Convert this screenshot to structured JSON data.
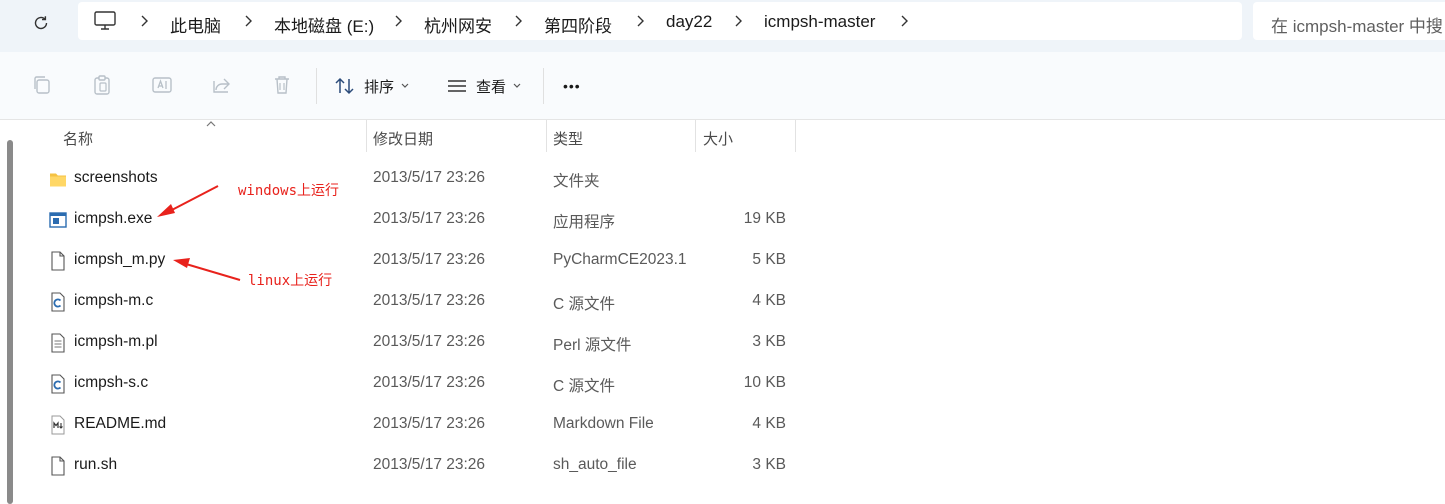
{
  "address": {
    "breadcrumbs": [
      "此电脑",
      "本地磁盘 (E:)",
      "杭州网安",
      "第四阶段",
      "day22",
      "icmpsh-master"
    ],
    "search_placeholder": "在 icmpsh-master 中搜"
  },
  "toolbar": {
    "sort_label": "排序",
    "view_label": "查看",
    "more_label": "•••"
  },
  "columns": {
    "name": "名称",
    "modified": "修改日期",
    "type": "类型",
    "size": "大小"
  },
  "files": [
    {
      "name": "screenshots",
      "modified": "2013/5/17 23:26",
      "type": "文件夹",
      "size": "",
      "icon": "folder-icon"
    },
    {
      "name": "icmpsh.exe",
      "modified": "2013/5/17 23:26",
      "type": "应用程序",
      "size": "19 KB",
      "icon": "exe-icon"
    },
    {
      "name": "icmpsh_m.py",
      "modified": "2013/5/17 23:26",
      "type": "PyCharmCE2023.1",
      "size": "5 KB",
      "icon": "file-icon"
    },
    {
      "name": "icmpsh-m.c",
      "modified": "2013/5/17 23:26",
      "type": "C 源文件",
      "size": "4 KB",
      "icon": "c-file-icon"
    },
    {
      "name": "icmpsh-m.pl",
      "modified": "2013/5/17 23:26",
      "type": "Perl 源文件",
      "size": "3 KB",
      "icon": "text-file-icon"
    },
    {
      "name": "icmpsh-s.c",
      "modified": "2013/5/17 23:26",
      "type": "C 源文件",
      "size": "10 KB",
      "icon": "c-file-icon"
    },
    {
      "name": "README.md",
      "modified": "2013/5/17 23:26",
      "type": "Markdown File",
      "size": "4 KB",
      "icon": "markdown-file-icon"
    },
    {
      "name": "run.sh",
      "modified": "2013/5/17 23:26",
      "type": "sh_auto_file",
      "size": "3 KB",
      "icon": "file-icon"
    }
  ],
  "annotations": {
    "windows_note": "windows上运行",
    "linux_note": "linux上运行"
  },
  "colors": {
    "annotation": "#e8221c",
    "folder": "#f5c242",
    "accent": "#2b6cb0"
  }
}
